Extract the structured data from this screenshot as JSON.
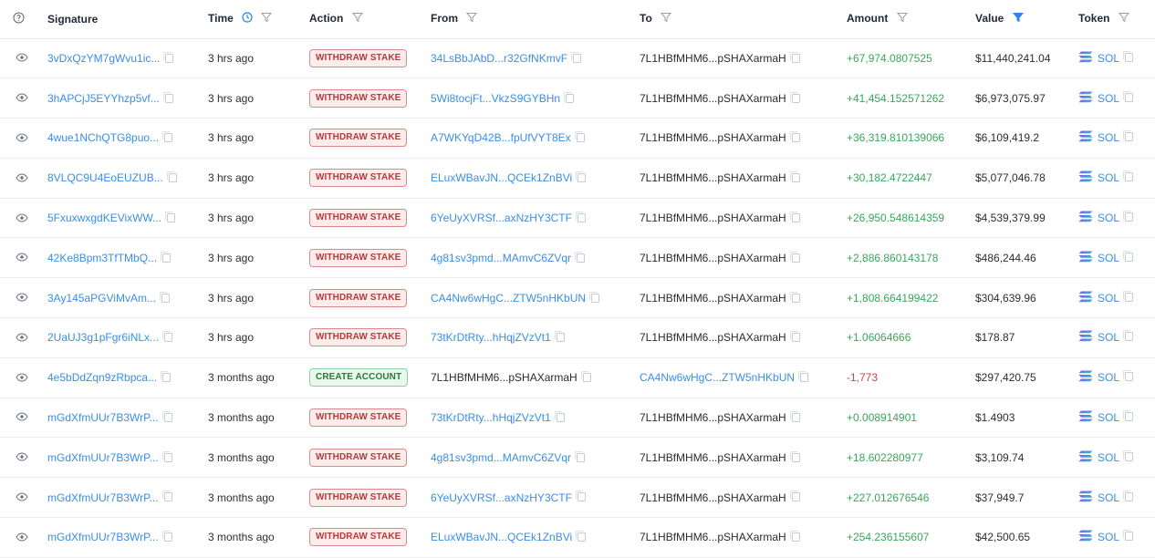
{
  "header": {
    "signature": "Signature",
    "time": "Time",
    "action": "Action",
    "from": "From",
    "to": "To",
    "amount": "Amount",
    "value": "Value",
    "token": "Token"
  },
  "rows": [
    {
      "signature": "3vDxQzYM7gWvu1ic...",
      "time": "3 hrs ago",
      "action": "WITHDRAW STAKE",
      "action_type": "withdraw",
      "from": "34LsBbJAbD...r32GfNKmvF",
      "from_link": true,
      "to": "7L1HBfMHM6...pSHAXarmaH",
      "to_link": false,
      "amount": "+67,974.0807525",
      "amount_sign": "pos",
      "value": "$11,440,241.04",
      "token": "SOL"
    },
    {
      "signature": "3hAPCjJ5EYYhzp5vf...",
      "time": "3 hrs ago",
      "action": "WITHDRAW STAKE",
      "action_type": "withdraw",
      "from": "5Wi8tocjFt...VkzS9GYBHn",
      "from_link": true,
      "to": "7L1HBfMHM6...pSHAXarmaH",
      "to_link": false,
      "amount": "+41,454.152571262",
      "amount_sign": "pos",
      "value": "$6,973,075.97",
      "token": "SOL"
    },
    {
      "signature": "4wue1NChQTG8puo...",
      "time": "3 hrs ago",
      "action": "WITHDRAW STAKE",
      "action_type": "withdraw",
      "from": "A7WKYqD42B...fpUfVYT8Ex",
      "from_link": true,
      "to": "7L1HBfMHM6...pSHAXarmaH",
      "to_link": false,
      "amount": "+36,319.810139066",
      "amount_sign": "pos",
      "value": "$6,109,419.2",
      "token": "SOL"
    },
    {
      "signature": "8VLQC9U4EoEUZUB...",
      "time": "3 hrs ago",
      "action": "WITHDRAW STAKE",
      "action_type": "withdraw",
      "from": "ELuxWBavJN...QCEk1ZnBVi",
      "from_link": true,
      "to": "7L1HBfMHM6...pSHAXarmaH",
      "to_link": false,
      "amount": "+30,182.4722447",
      "amount_sign": "pos",
      "value": "$5,077,046.78",
      "token": "SOL"
    },
    {
      "signature": "5FxuxwxgdKEVixWW...",
      "time": "3 hrs ago",
      "action": "WITHDRAW STAKE",
      "action_type": "withdraw",
      "from": "6YeUyXVRSf...axNzHY3CTF",
      "from_link": true,
      "to": "7L1HBfMHM6...pSHAXarmaH",
      "to_link": false,
      "amount": "+26,950.548614359",
      "amount_sign": "pos",
      "value": "$4,539,379.99",
      "token": "SOL"
    },
    {
      "signature": "42Ke8Bpm3TfTMbQ...",
      "time": "3 hrs ago",
      "action": "WITHDRAW STAKE",
      "action_type": "withdraw",
      "from": "4g81sv3pmd...MAmvC6ZVqr",
      "from_link": true,
      "to": "7L1HBfMHM6...pSHAXarmaH",
      "to_link": false,
      "amount": "+2,886.860143178",
      "amount_sign": "pos",
      "value": "$486,244.46",
      "token": "SOL"
    },
    {
      "signature": "3Ay145aPGViMvAm...",
      "time": "3 hrs ago",
      "action": "WITHDRAW STAKE",
      "action_type": "withdraw",
      "from": "CA4Nw6wHgC...ZTW5nHKbUN",
      "from_link": true,
      "to": "7L1HBfMHM6...pSHAXarmaH",
      "to_link": false,
      "amount": "+1,808.664199422",
      "amount_sign": "pos",
      "value": "$304,639.96",
      "token": "SOL"
    },
    {
      "signature": "2UaUJ3g1pFgr6iNLx...",
      "time": "3 hrs ago",
      "action": "WITHDRAW STAKE",
      "action_type": "withdraw",
      "from": "73tKrDtRty...hHqjZVzVt1",
      "from_link": true,
      "to": "7L1HBfMHM6...pSHAXarmaH",
      "to_link": false,
      "amount": "+1.06064666",
      "amount_sign": "pos",
      "value": "$178.87",
      "token": "SOL"
    },
    {
      "signature": "4e5bDdZqn9zRbpca...",
      "time": "3 months ago",
      "action": "CREATE ACCOUNT",
      "action_type": "create",
      "from": "7L1HBfMHM6...pSHAXarmaH",
      "from_link": false,
      "to": "CA4Nw6wHgC...ZTW5nHKbUN",
      "to_link": true,
      "amount": "-1,773",
      "amount_sign": "neg",
      "value": "$297,420.75",
      "token": "SOL"
    },
    {
      "signature": "mGdXfmUUr7B3WrP...",
      "time": "3 months ago",
      "action": "WITHDRAW STAKE",
      "action_type": "withdraw",
      "from": "73tKrDtRty...hHqjZVzVt1",
      "from_link": true,
      "to": "7L1HBfMHM6...pSHAXarmaH",
      "to_link": false,
      "amount": "+0.008914901",
      "amount_sign": "pos",
      "value": "$1.4903",
      "token": "SOL"
    },
    {
      "signature": "mGdXfmUUr7B3WrP...",
      "time": "3 months ago",
      "action": "WITHDRAW STAKE",
      "action_type": "withdraw",
      "from": "4g81sv3pmd...MAmvC6ZVqr",
      "from_link": true,
      "to": "7L1HBfMHM6...pSHAXarmaH",
      "to_link": false,
      "amount": "+18.602280977",
      "amount_sign": "pos",
      "value": "$3,109.74",
      "token": "SOL"
    },
    {
      "signature": "mGdXfmUUr7B3WrP...",
      "time": "3 months ago",
      "action": "WITHDRAW STAKE",
      "action_type": "withdraw",
      "from": "6YeUyXVRSf...axNzHY3CTF",
      "from_link": true,
      "to": "7L1HBfMHM6...pSHAXarmaH",
      "to_link": false,
      "amount": "+227.012676546",
      "amount_sign": "pos",
      "value": "$37,949.7",
      "token": "SOL"
    },
    {
      "signature": "mGdXfmUUr7B3WrP...",
      "time": "3 months ago",
      "action": "WITHDRAW STAKE",
      "action_type": "withdraw",
      "from": "ELuxWBavJN...QCEk1ZnBVi",
      "from_link": true,
      "to": "7L1HBfMHM6...pSHAXarmaH",
      "to_link": false,
      "amount": "+254.236155607",
      "amount_sign": "pos",
      "value": "$42,500.65",
      "token": "SOL"
    }
  ],
  "icons": {
    "help": "question-circle-icon",
    "time_toggle": "clock-icon",
    "filter": "funnel-icon",
    "filter_active": "funnel-filled-icon",
    "view": "eye-icon",
    "copy": "copy-icon",
    "token": "solana-logo-icon"
  },
  "colors": {
    "link": "#3a8ee6",
    "positive": "#3aa65a",
    "negative": "#d0434b",
    "withdraw_badge": "#b53a3a",
    "create_badge": "#2b7a3c",
    "filter_active": "#2a86e8"
  }
}
